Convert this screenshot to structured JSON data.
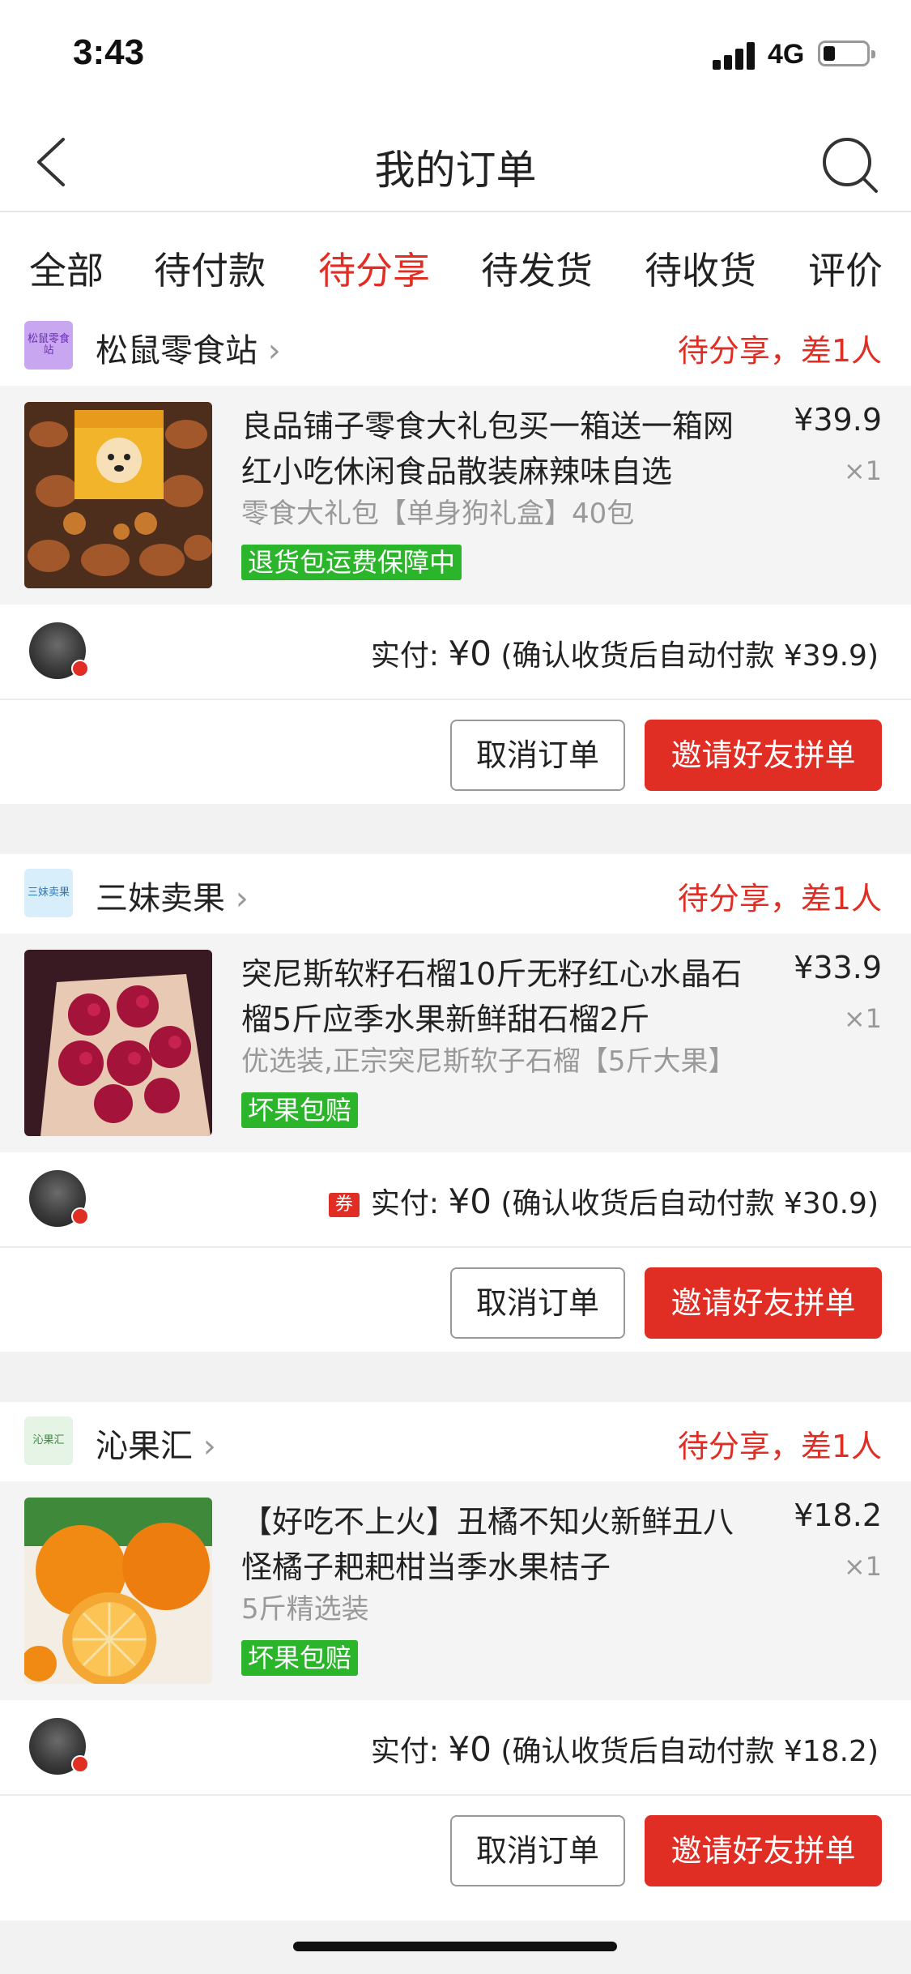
{
  "status_bar": {
    "time": "3:43",
    "network": "4G"
  },
  "nav": {
    "title": "我的订单"
  },
  "tabs": [
    {
      "label": "全部"
    },
    {
      "label": "待付款"
    },
    {
      "label": "待分享",
      "active": true
    },
    {
      "label": "待发货"
    },
    {
      "label": "待收货"
    },
    {
      "label": "评价"
    }
  ],
  "orders": [
    {
      "shop_name": "松鼠零食站",
      "shop_logo_text": "松鼠零食站",
      "status": "待分享，差1人",
      "title": "良品铺子零食大礼包买一箱送一箱网红小吃休闲食品散装麻辣味自选",
      "spec": "零食大礼包【单身狗礼盒】40包",
      "tag": "退货包运费保障中",
      "price": "¥39.9",
      "qty": "×1",
      "pay_label": "实付: ",
      "pay_amount": "¥0",
      "pay_note": " (确认收货后自动付款 ¥39.9)",
      "has_coupon": false,
      "cancel_label": "取消订单",
      "invite_label": "邀请好友拼单"
    },
    {
      "shop_name": "三妹卖果",
      "shop_logo_text": "三妹卖果",
      "status": "待分享，差1人",
      "title": "突尼斯软籽石榴10斤无籽红心水晶石榴5斤应季水果新鲜甜石榴2斤",
      "spec": "优选装,正宗突尼斯软子石榴【5斤大果】",
      "tag": "坏果包赔",
      "price": "¥33.9",
      "qty": "×1",
      "pay_label": "实付: ",
      "pay_amount": "¥0",
      "pay_note": " (确认收货后自动付款 ¥30.9)",
      "coupon_label": "券",
      "has_coupon": true,
      "cancel_label": "取消订单",
      "invite_label": "邀请好友拼单"
    },
    {
      "shop_name": "沁果汇",
      "shop_logo_text": "沁果汇",
      "status": "待分享，差1人",
      "title": "【好吃不上火】丑橘不知火新鲜丑八怪橘子耙耙柑当季水果桔子",
      "spec": "5斤精选装",
      "tag": "坏果包赔",
      "price": "¥18.2",
      "qty": "×1",
      "pay_label": "实付: ",
      "pay_amount": "¥0",
      "pay_note": " (确认收货后自动付款 ¥18.2)",
      "has_coupon": false,
      "cancel_label": "取消订单",
      "invite_label": "邀请好友拼单"
    }
  ],
  "colors": {
    "accent": "#e02e24",
    "tag_green": "#2bb52b",
    "bg": "#f2f2f2"
  }
}
